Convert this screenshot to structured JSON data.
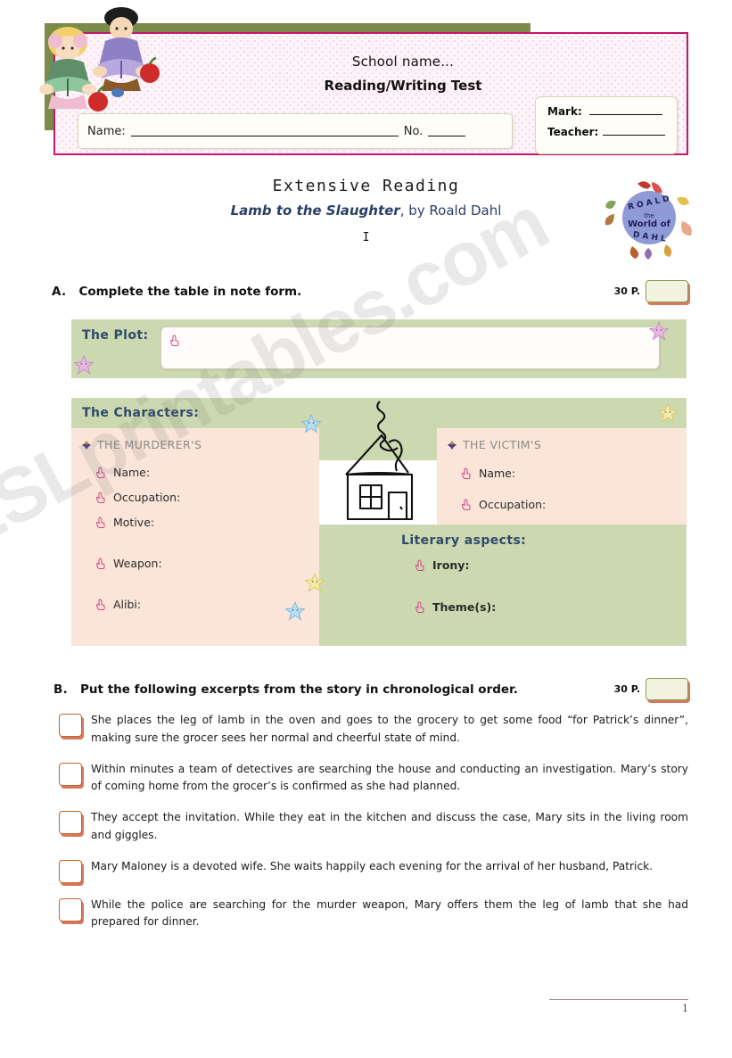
{
  "header": {
    "school_name": "School name...",
    "test_title": "Reading/Writing Test",
    "name_label": "Name:",
    "no_label": "No.",
    "mark_label": "Mark:",
    "teacher_label": "Teacher:",
    "kids_clipart_alt": "two children reading books",
    "border_color": "#c2176b",
    "olive_color": "#7b8b4a"
  },
  "title": {
    "main": "Extensive  Reading",
    "work_title": "Lamb to the Slaughter",
    "work_author": ", by Roald Dahl",
    "part_number": "I",
    "logo_alt": "The World of Roald Dahl"
  },
  "exercise_a": {
    "letter": "A.",
    "prompt": "Complete the table in note form.",
    "points": "30 P.",
    "plot": {
      "label": "The Plot:"
    },
    "characters": {
      "label": "The Characters:",
      "murderer": {
        "heading": "THE MURDERER'S",
        "fields": [
          "Name:",
          "Occupation:",
          "Motive:",
          "Weapon:",
          "Alibi:"
        ]
      },
      "victim": {
        "heading": "THE VICTIM'S",
        "fields": [
          "Name:",
          "Occupation:"
        ]
      },
      "literary": {
        "label": "Literary aspects:",
        "fields": [
          "Irony:",
          "Theme(s):"
        ]
      }
    }
  },
  "exercise_b": {
    "letter": "B.",
    "prompt": "Put the following excerpts from the story in chronological order.",
    "points": "30 P.",
    "excerpts": [
      "She places the leg of lamb in the oven and goes to the grocery to get some food “for Patrick’s dinner”, making sure the grocer sees her normal and cheerful state of mind.",
      "Within minutes a team of detectives are searching the house and conducting an investigation. Mary’s story of coming home from the grocer’s is confirmed as she had planned.",
      "They accept the invitation. While they eat in the kitchen and discuss the case, Mary sits in the living room and giggles.",
      "Mary Maloney is a devoted wife. She waits happily each evening for the arrival of her husband, Patrick.",
      "While the police are searching for the murder weapon, Mary offers them the leg of lamb that she had prepared for dinner."
    ]
  },
  "footer": {
    "page_number": "1"
  },
  "watermark": {
    "text": "ESLprintables.com"
  },
  "colors": {
    "panel_green": "#ccd9b0",
    "panel_peach": "#fae5d8",
    "heading_blue": "#2f4a6b",
    "accent_pink": "#c2176b",
    "box_shadow_salmon": "#d4795c"
  }
}
